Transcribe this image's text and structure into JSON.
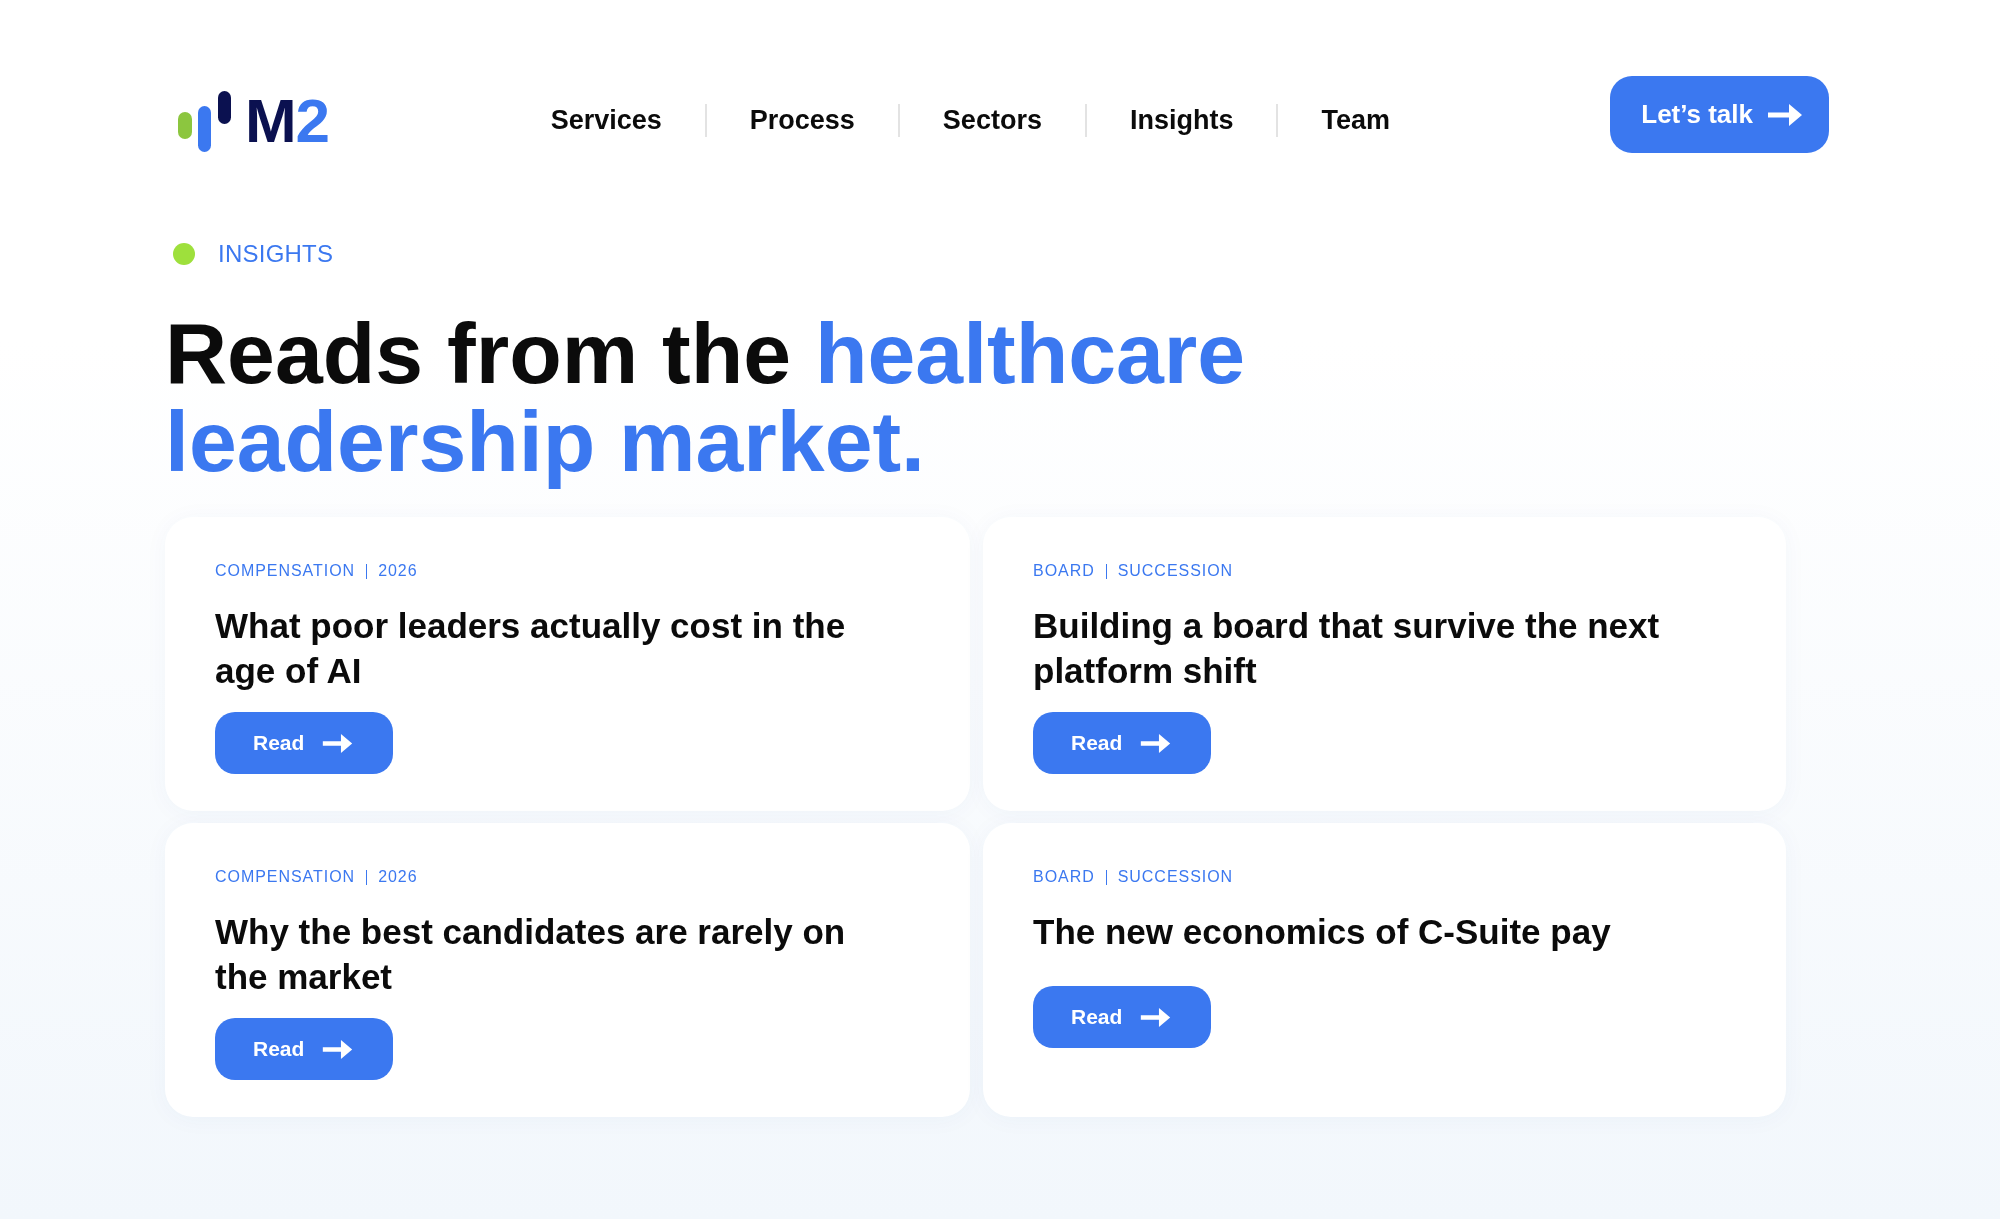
{
  "logo": {
    "parts": [
      {
        "text": "M",
        "accent": false
      },
      {
        "text": "2",
        "accent": true
      }
    ]
  },
  "nav": [
    "Services",
    "Process",
    "Sectors",
    "Insights",
    "Team"
  ],
  "cta_button": {
    "label": "Let’s talk"
  },
  "section_label": "INSIGHTS",
  "heading": [
    {
      "text": "Reads from the",
      "accent": false
    },
    {
      "text": "healthcare leadership market.",
      "accent": true
    }
  ],
  "articles": [
    {
      "tags": [
        "COMPENSATION",
        "2026"
      ],
      "title": "What poor leaders actually cost in the age of AI",
      "button": "Read"
    },
    {
      "tags": [
        "BOARD",
        "SUCCESSION"
      ],
      "title": "Building a board that survive the next platform shift",
      "button": "Read"
    },
    {
      "tags": [
        "COMPENSATION",
        "2026"
      ],
      "title": "Why the best candidates are rarely on the market",
      "button": "Read"
    },
    {
      "tags": [
        "BOARD",
        "SUCCESSION"
      ],
      "title": "The new economics of C-Suite pay",
      "button": "Read"
    }
  ]
}
